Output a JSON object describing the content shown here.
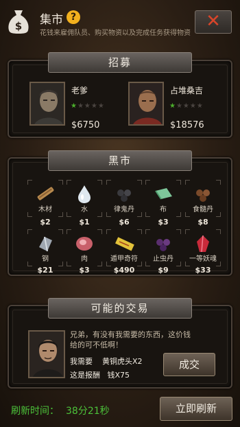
{
  "header": {
    "title": "集市",
    "help": "?",
    "subtitle": "花钱来雇佣队员、购买物资以及完成任务获得物资",
    "close": "✕"
  },
  "recruit": {
    "tab": "招募",
    "candidates": [
      {
        "name": "老爹",
        "stars_filled": 1,
        "stars_total": 5,
        "price": "$6750"
      },
      {
        "name": "占堆桑吉",
        "stars_filled": 1,
        "stars_total": 5,
        "price": "$18576"
      }
    ]
  },
  "market": {
    "tab": "黑市",
    "items": [
      {
        "name": "木材",
        "price": "$2",
        "icon": "wood-icon"
      },
      {
        "name": "水",
        "price": "$1",
        "icon": "water-drop-icon"
      },
      {
        "name": "律鬼丹",
        "price": "$6",
        "icon": "black-pills-icon"
      },
      {
        "name": "布",
        "price": "$3",
        "icon": "cloth-icon"
      },
      {
        "name": "食髓丹",
        "price": "$8",
        "icon": "brown-pills-icon"
      },
      {
        "name": "钢",
        "price": "$21",
        "icon": "steel-icon"
      },
      {
        "name": "肉",
        "price": "$3",
        "icon": "meat-icon"
      },
      {
        "name": "遁甲奇符",
        "price": "$490",
        "icon": "talisman-icon"
      },
      {
        "name": "止虫丹",
        "price": "$9",
        "icon": "purple-pills-icon"
      },
      {
        "name": "一等妖魂",
        "price": "$33",
        "icon": "red-crystal-icon"
      }
    ]
  },
  "trade": {
    "tab": "可能的交易",
    "message": "兄弟，有没有我需要的东西，这价钱给的可不低啊！",
    "need_label": "我需要",
    "need_value": "黄铜虎头X2",
    "reward_label": "这是报酬",
    "reward_value": "钱X75",
    "deal_button": "成交"
  },
  "footer": {
    "refresh_label": "刷新时间：",
    "refresh_time": "38分21秒",
    "refresh_button": "立即刷新"
  },
  "colors": {
    "accent_green": "#4cc23a",
    "star_on": "#4caf2c",
    "close_red": "#d8452a",
    "help_yellow": "#f2b01e"
  }
}
